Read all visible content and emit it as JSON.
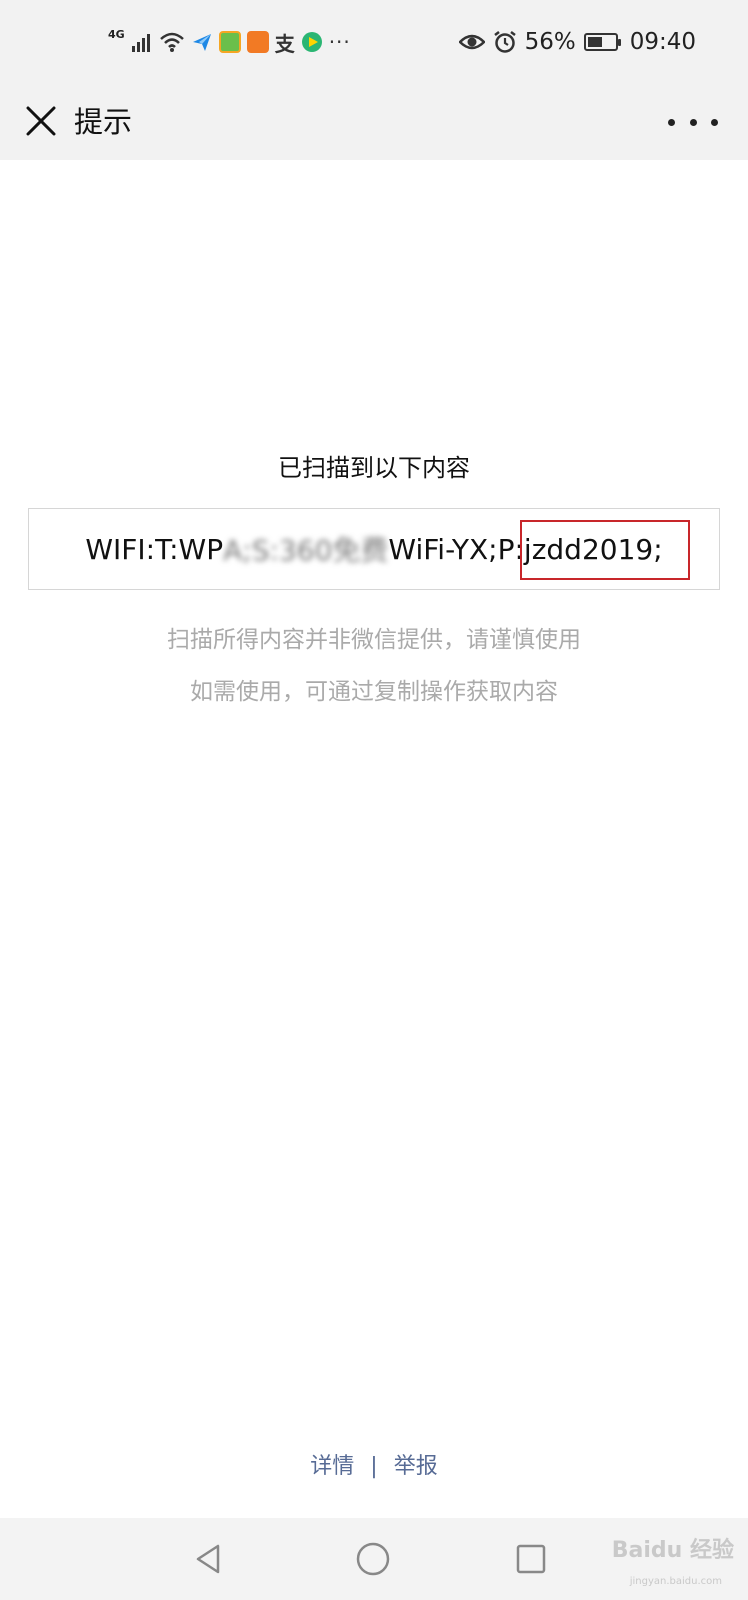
{
  "status_bar": {
    "network": "4G",
    "battery_percent": "56%",
    "time": "09:40",
    "battery_level": 0.56,
    "icons": [
      "signal-icon",
      "wifi-icon",
      "send-app-icon",
      "green-app-icon",
      "uc-browser-icon",
      "alipay-icon",
      "video-app-icon",
      "more-dots-icon",
      "eye-icon",
      "alarm-icon",
      "battery-icon"
    ]
  },
  "titlebar": {
    "title": "提示"
  },
  "content": {
    "heading": "已扫描到以下内容",
    "scan_prefix": "WIFI:T:WPA;S:360免费",
    "scan_middle": "WiFi-YX;P",
    "scan_password": ":jzdd2019;",
    "note_line1": "扫描所得内容并非微信提供，请谨慎使用",
    "note_line2": "如需使用，可通过复制操作获取内容",
    "highlight_color": "#c8262a"
  },
  "footer": {
    "details": "详情",
    "separator": "|",
    "report": "举报",
    "link_color": "#576b95"
  },
  "watermark": {
    "brand": "Baidu 经验",
    "url": "jingyan.baidu.com"
  }
}
